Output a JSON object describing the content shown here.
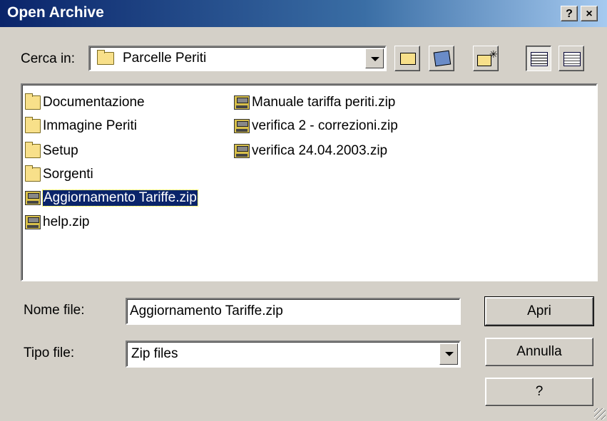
{
  "window": {
    "title": "Open Archive",
    "help_button": "?",
    "close_button": "×"
  },
  "lookin": {
    "label": "Cerca in:",
    "value": "Parcelle Periti"
  },
  "toolbar": {
    "buttons": [
      {
        "name": "up-folder"
      },
      {
        "name": "desktop"
      },
      {
        "name": "new-folder"
      },
      {
        "name": "list-view"
      },
      {
        "name": "details-view"
      }
    ]
  },
  "files": {
    "col1": [
      {
        "name": "Documentazione",
        "type": "folder"
      },
      {
        "name": "Immagine Periti",
        "type": "folder"
      },
      {
        "name": "Setup",
        "type": "folder"
      },
      {
        "name": "Sorgenti",
        "type": "folder"
      },
      {
        "name": "Aggiornamento Tariffe.zip",
        "type": "zip",
        "selected": true
      },
      {
        "name": "help.zip",
        "type": "zip"
      }
    ],
    "col2": [
      {
        "name": "Manuale tariffa periti.zip",
        "type": "zip"
      },
      {
        "name": "verifica 2 - correzioni.zip",
        "type": "zip"
      },
      {
        "name": "verifica 24.04.2003.zip",
        "type": "zip"
      }
    ]
  },
  "filename": {
    "label": "Nome file:",
    "value": "Aggiornamento Tariffe.zip"
  },
  "filetype": {
    "label": "Tipo file:",
    "value": "Zip files"
  },
  "buttons": {
    "open": "Apri",
    "cancel": "Annulla",
    "help": "?"
  }
}
